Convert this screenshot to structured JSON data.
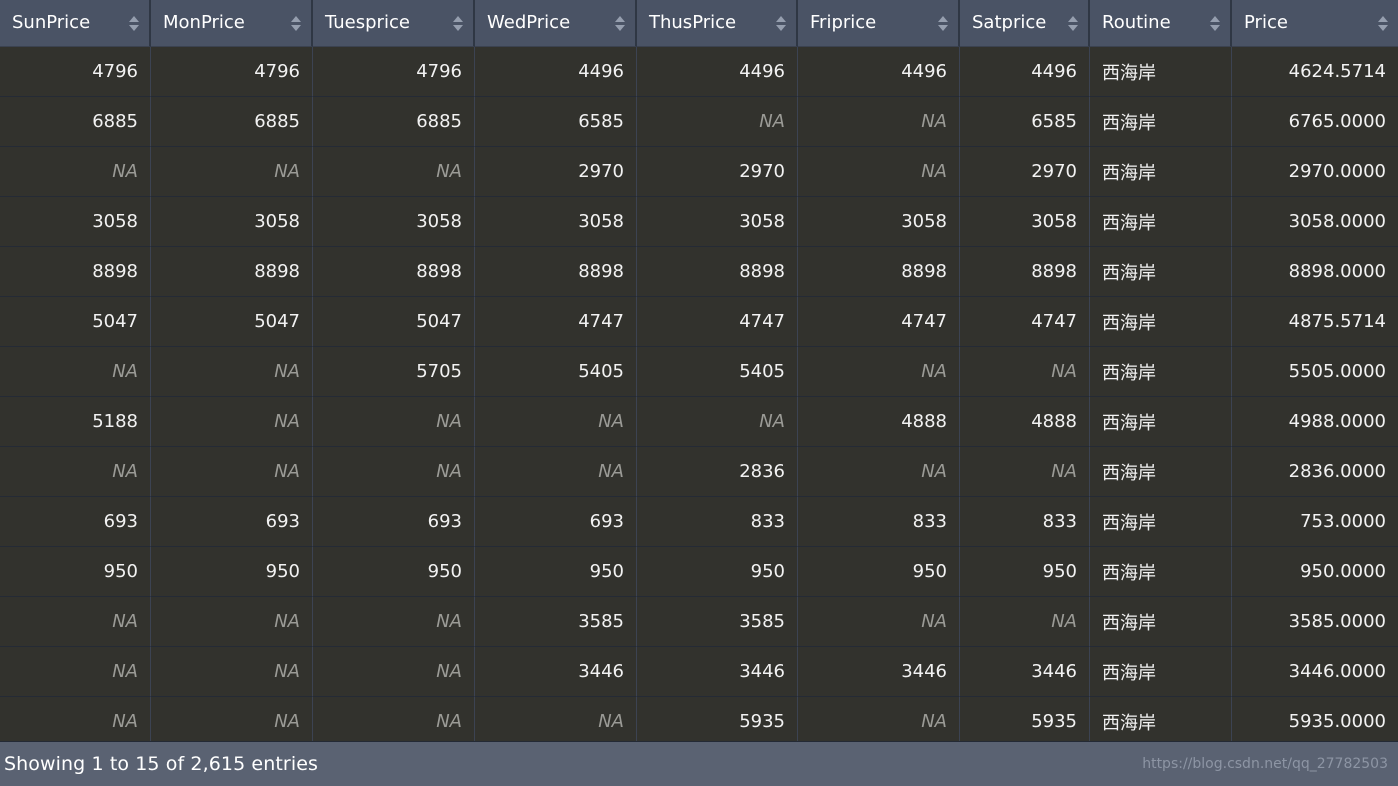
{
  "table": {
    "columns": [
      {
        "id": "sunprice",
        "label": "SunPrice",
        "align": "right",
        "sortable": true
      },
      {
        "id": "monprice",
        "label": "MonPrice",
        "align": "right",
        "sortable": true
      },
      {
        "id": "tuesprice",
        "label": "Tuesprice",
        "align": "right",
        "sortable": true
      },
      {
        "id": "wedprice",
        "label": "WedPrice",
        "align": "right",
        "sortable": true
      },
      {
        "id": "thusprice",
        "label": "ThusPrice",
        "align": "right",
        "sortable": true
      },
      {
        "id": "friprice",
        "label": "Friprice",
        "align": "right",
        "sortable": true
      },
      {
        "id": "satprice",
        "label": "Satprice",
        "align": "right",
        "sortable": true
      },
      {
        "id": "routine",
        "label": "Routine",
        "align": "left",
        "sortable": true
      },
      {
        "id": "price",
        "label": "Price",
        "align": "right",
        "sortable": true
      }
    ],
    "sort_icon_name": "sort-both-icon",
    "na_text": "NA",
    "rows": [
      [
        "4796",
        "4796",
        "4796",
        "4496",
        "4496",
        "4496",
        "4496",
        "西海岸",
        "4624.5714"
      ],
      [
        "6885",
        "6885",
        "6885",
        "6585",
        "NA",
        "NA",
        "6585",
        "西海岸",
        "6765.0000"
      ],
      [
        "NA",
        "NA",
        "NA",
        "2970",
        "2970",
        "NA",
        "2970",
        "西海岸",
        "2970.0000"
      ],
      [
        "3058",
        "3058",
        "3058",
        "3058",
        "3058",
        "3058",
        "3058",
        "西海岸",
        "3058.0000"
      ],
      [
        "8898",
        "8898",
        "8898",
        "8898",
        "8898",
        "8898",
        "8898",
        "西海岸",
        "8898.0000"
      ],
      [
        "5047",
        "5047",
        "5047",
        "4747",
        "4747",
        "4747",
        "4747",
        "西海岸",
        "4875.5714"
      ],
      [
        "NA",
        "NA",
        "5705",
        "5405",
        "5405",
        "NA",
        "NA",
        "西海岸",
        "5505.0000"
      ],
      [
        "5188",
        "NA",
        "NA",
        "NA",
        "NA",
        "4888",
        "4888",
        "西海岸",
        "4988.0000"
      ],
      [
        "NA",
        "NA",
        "NA",
        "NA",
        "2836",
        "NA",
        "NA",
        "西海岸",
        "2836.0000"
      ],
      [
        "693",
        "693",
        "693",
        "693",
        "833",
        "833",
        "833",
        "西海岸",
        "753.0000"
      ],
      [
        "950",
        "950",
        "950",
        "950",
        "950",
        "950",
        "950",
        "西海岸",
        "950.0000"
      ],
      [
        "NA",
        "NA",
        "NA",
        "3585",
        "3585",
        "NA",
        "NA",
        "西海岸",
        "3585.0000"
      ],
      [
        "NA",
        "NA",
        "NA",
        "3446",
        "3446",
        "3446",
        "3446",
        "西海岸",
        "3446.0000"
      ],
      [
        "NA",
        "NA",
        "NA",
        "NA",
        "5935",
        "NA",
        "5935",
        "西海岸",
        "5935.0000"
      ]
    ]
  },
  "footer": {
    "info": "Showing 1 to 15 of 2,615 entries",
    "watermark": "https://blog.csdn.net/qq_27782503"
  },
  "colors": {
    "header_bg": "#4a5365",
    "row_bg": "#32322d",
    "footer_bg": "#5a6272",
    "text": "#f2f2f2",
    "na_text": "#9b9b96",
    "border": "#3c4352"
  }
}
